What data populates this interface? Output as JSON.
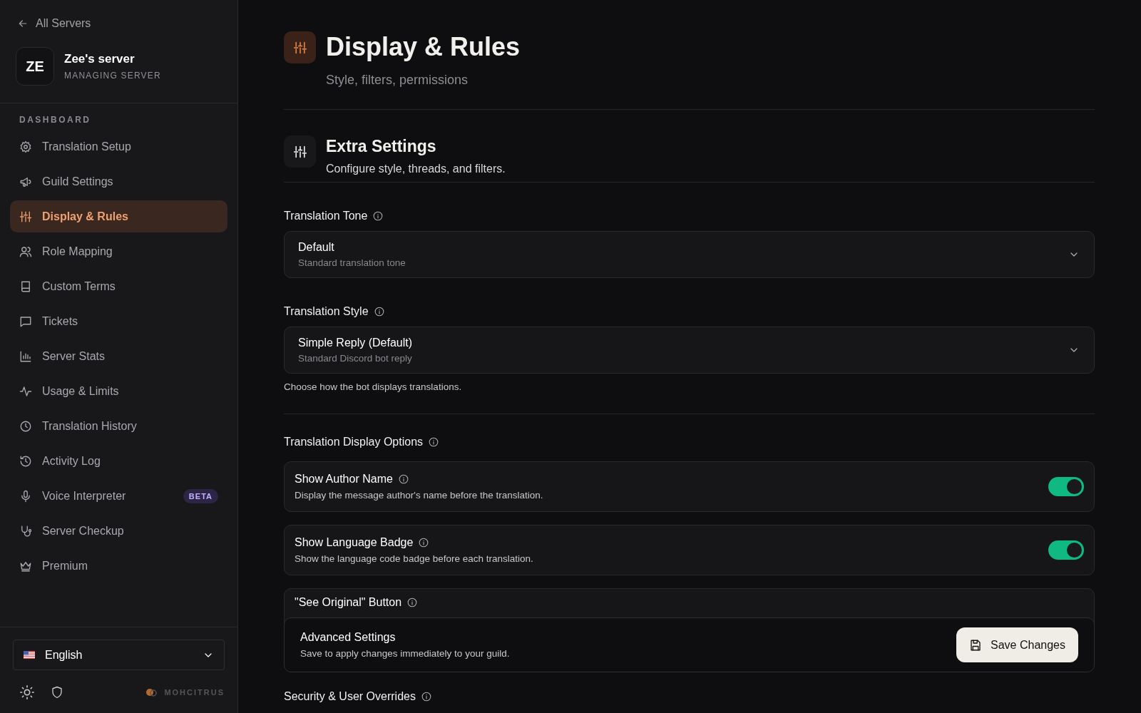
{
  "sidebar": {
    "back_link": "All Servers",
    "server": {
      "initials": "ZE",
      "name": "Zee's server",
      "subtitle": "MANAGING SERVER"
    },
    "section_label": "DASHBOARD",
    "items": [
      {
        "label": "Translation Setup",
        "selected": false
      },
      {
        "label": "Guild Settings",
        "selected": false
      },
      {
        "label": "Display & Rules",
        "selected": true
      },
      {
        "label": "Role Mapping",
        "selected": false
      },
      {
        "label": "Custom Terms",
        "selected": false
      },
      {
        "label": "Tickets",
        "selected": false
      },
      {
        "label": "Server Stats",
        "selected": false
      },
      {
        "label": "Usage & Limits",
        "selected": false
      },
      {
        "label": "Translation History",
        "selected": false
      },
      {
        "label": "Activity Log",
        "selected": false
      },
      {
        "label": "Voice Interpreter",
        "selected": false,
        "badge": "BETA"
      },
      {
        "label": "Server Checkup",
        "selected": false
      },
      {
        "label": "Premium",
        "selected": false
      }
    ],
    "language": {
      "value": "English"
    },
    "brand": "MOHCITRUS"
  },
  "header": {
    "title": "Display & Rules",
    "subtitle": "Style, filters, permissions"
  },
  "section": {
    "title": "Extra Settings",
    "description": "Configure style, threads, and filters."
  },
  "selects": [
    {
      "label": "Translation Tone",
      "value": "Default",
      "description": "Standard translation tone"
    },
    {
      "label": "Translation Style",
      "value": "Simple Reply (Default)",
      "description": "Standard Discord bot reply",
      "hint": "Choose how the bot displays translations."
    }
  ],
  "display_options": {
    "label": "Translation Display Options",
    "options": [
      {
        "title": "Show Author Name",
        "description": "Display the message author's name before the translation.",
        "on": true
      },
      {
        "title": "Show Language Badge",
        "description": "Show the language code badge before each translation.",
        "on": true
      },
      {
        "title": "\"See Original\" Button"
      }
    ]
  },
  "save_bar": {
    "title": "Advanced Settings",
    "description": "Save to apply changes immediately to your guild.",
    "button": "Save Changes"
  },
  "next_section": {
    "label": "Security & User Overrides"
  }
}
